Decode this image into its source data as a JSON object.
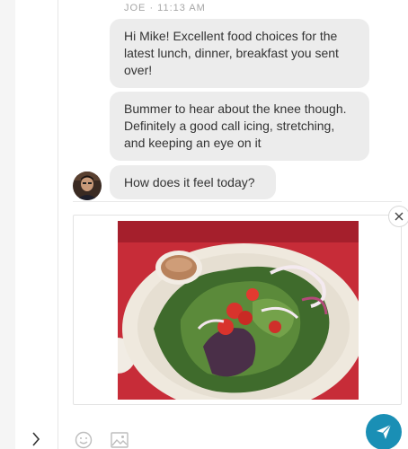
{
  "thread": {
    "meta": "JOE · 11:13 AM",
    "messages": [
      {
        "text": "Hi Mike! Excellent food choices for the latest lunch, dinner, breakfast you sent over!"
      },
      {
        "text": "Bummer to hear about the knee though. Definitely a good call icing, stretching, and keeping an eye on it"
      },
      {
        "text": "How does it feel today?"
      }
    ]
  },
  "icons": {
    "collapse": "chevron-right-icon",
    "remove": "close-icon",
    "emoji": "smiley-icon",
    "image": "image-icon",
    "send": "paper-plane-icon"
  },
  "colors": {
    "bubble": "#ececec",
    "send": "#1a8fb5",
    "meta": "#a6a6a6"
  }
}
